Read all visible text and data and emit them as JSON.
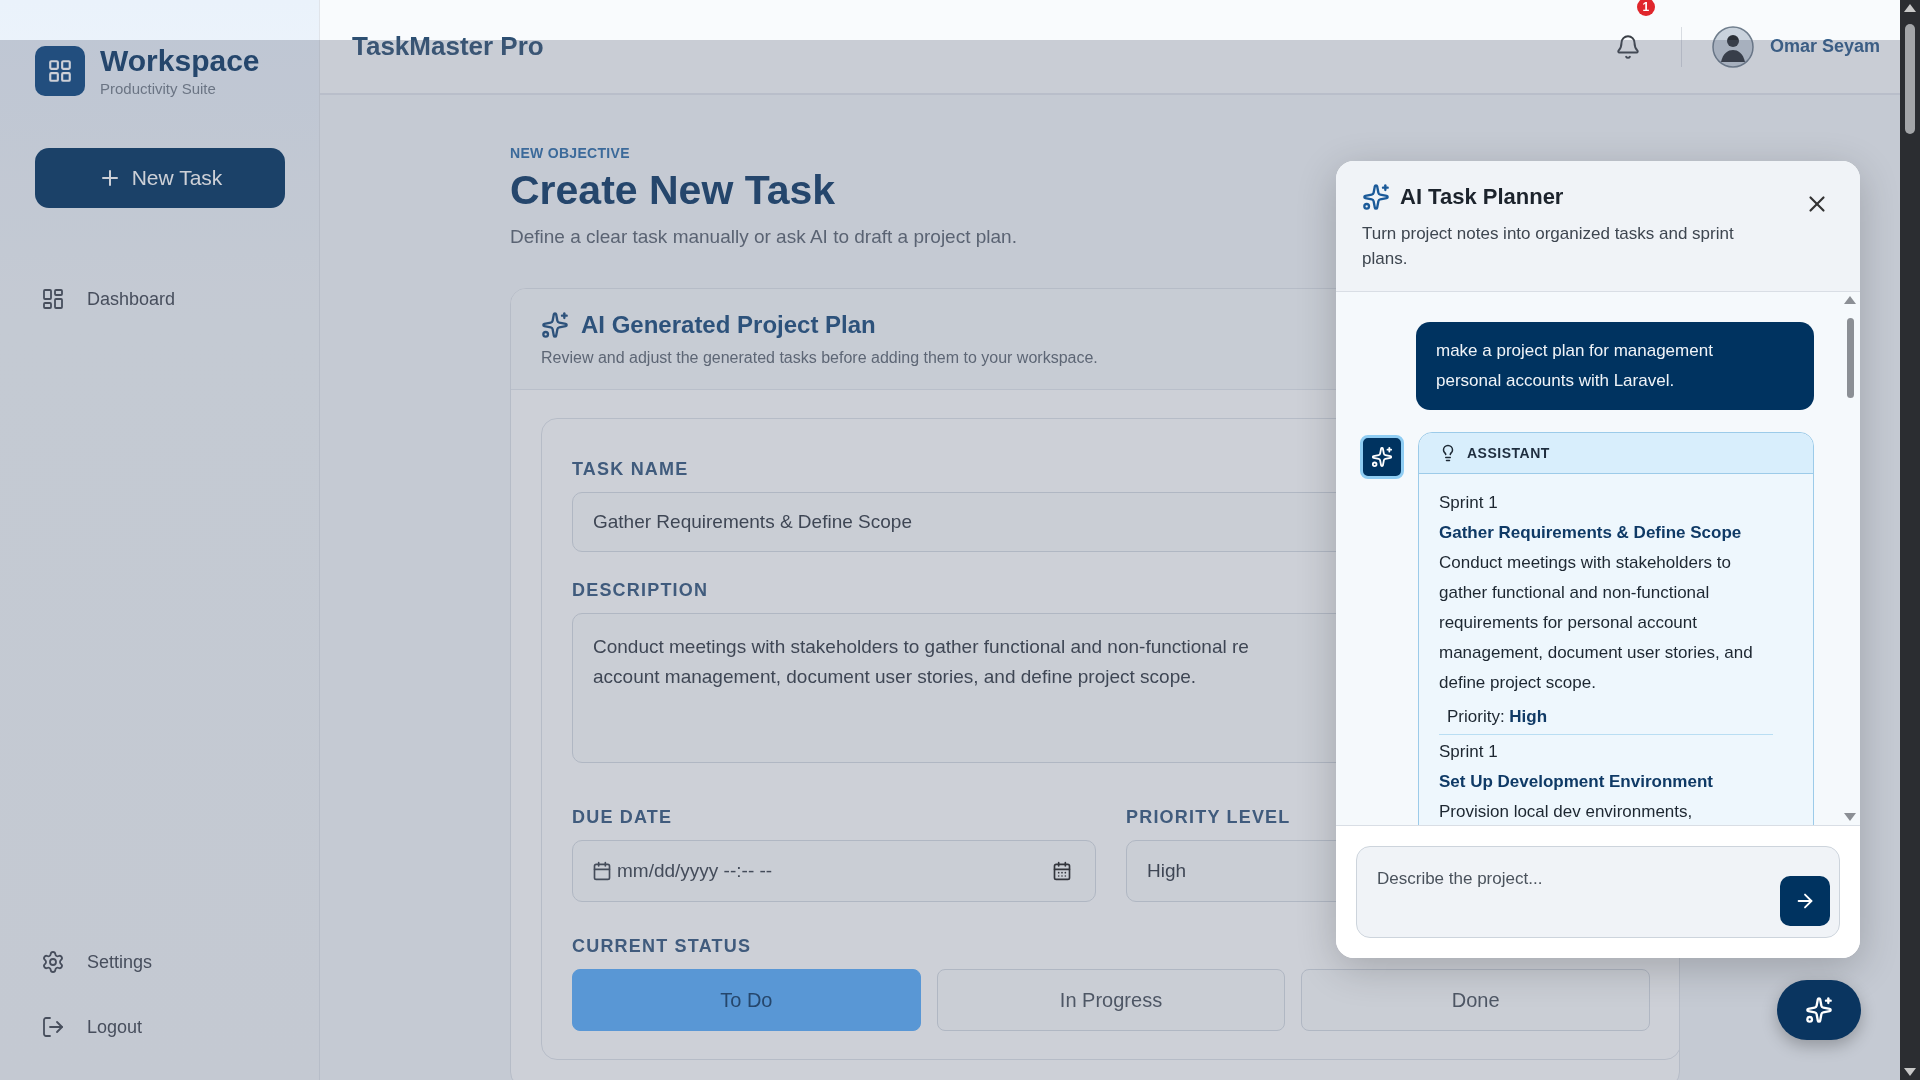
{
  "sidebar": {
    "brand": {
      "title": "Workspace",
      "subtitle": "Productivity Suite"
    },
    "new_task_button": "New Task",
    "nav_items": [
      {
        "label": "Dashboard",
        "selected": false
      }
    ],
    "footer_items": [
      {
        "label": "Settings"
      },
      {
        "label": "Logout"
      }
    ]
  },
  "header": {
    "title": "TaskMaster Pro",
    "notification_count": "1",
    "user_name": "Omar Seyam"
  },
  "page": {
    "eyebrow": "NEW OBJECTIVE",
    "title": "Create New Task",
    "subtitle": "Define a clear task manually or ask AI to draft a project plan."
  },
  "plan_card": {
    "title": "AI Generated Project Plan",
    "subtitle": "Review and adjust the generated tasks before adding them to your workspace."
  },
  "task_form": {
    "task_name": {
      "label": "TASK NAME",
      "value": "Gather Requirements & Define Scope"
    },
    "description": {
      "label": "DESCRIPTION",
      "lines": [
        "Conduct meetings with stakeholders to gather functional and non-functional re",
        "account management, document user stories, and define project scope."
      ]
    },
    "due_date": {
      "label": "DUE DATE",
      "placeholder": "mm/dd/yyyy --:-- --"
    },
    "priority": {
      "label": "PRIORITY LEVEL",
      "value": "High"
    },
    "status": {
      "label": "CURRENT STATUS",
      "options": [
        {
          "label": "To Do",
          "selected": true
        },
        {
          "label": "In Progress",
          "selected": false
        },
        {
          "label": "Done",
          "selected": false
        }
      ]
    }
  },
  "ai_panel": {
    "title": "AI Task Planner",
    "subtitle": "Turn project notes into organized tasks and sprint plans.",
    "messages": [
      {
        "kind": "user",
        "text": "make a project plan for management personal accounts with Laravel."
      },
      {
        "kind": "assistant",
        "label": "ASSISTANT",
        "items": [
          {
            "sprint": "Sprint 1",
            "title": "Gather Requirements & Define Scope",
            "description": "Conduct meetings with stakeholders to gather functional and non-functional requirements for personal account management, document user stories, and define project scope.",
            "priority": "Priority: **High**"
          },
          {
            "sprint": "Sprint 1",
            "title": "Set Up Development Environment",
            "description": "Provision local dev environments,"
          }
        ]
      }
    ],
    "input": {
      "placeholder": "Describe the project..."
    }
  }
}
